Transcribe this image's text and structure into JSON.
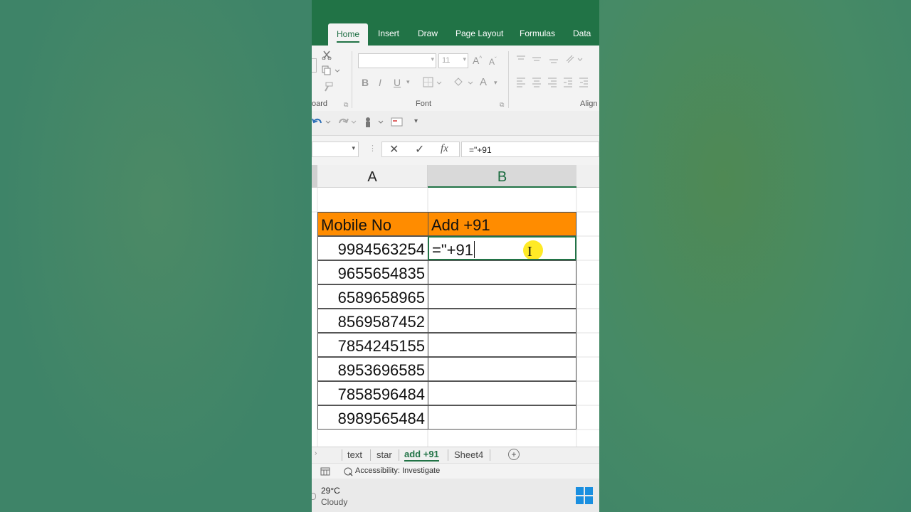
{
  "ribbon_tabs": [
    "Home",
    "Insert",
    "Draw",
    "Page Layout",
    "Formulas",
    "Data"
  ],
  "ribbon": {
    "clipboard_label": "oard",
    "font_label": "Font",
    "alignment_label": "Align",
    "font_size": "11"
  },
  "formula_bar": {
    "fx_label": "fx",
    "formula": "=\"+91"
  },
  "columns": [
    "A",
    "B"
  ],
  "table": {
    "header_a": "Mobile No",
    "header_b": "Add +91",
    "rows": [
      "9984563254",
      "9655654835",
      "6589658965",
      "8569587452",
      "7854245155",
      "8953696585",
      "7858596484",
      "8989565484"
    ],
    "editing_text": "=\"+91"
  },
  "sheet_tabs": [
    "text",
    "star",
    "add +91",
    "Sheet4"
  ],
  "status": {
    "accessibility": "Accessibility: Investigate"
  },
  "taskbar": {
    "temperature": "29°C",
    "weather": "Cloudy"
  },
  "colors": {
    "excel_green": "#217346",
    "header_fill": "#ff8c00",
    "cursor_highlight": "#ffe600"
  }
}
